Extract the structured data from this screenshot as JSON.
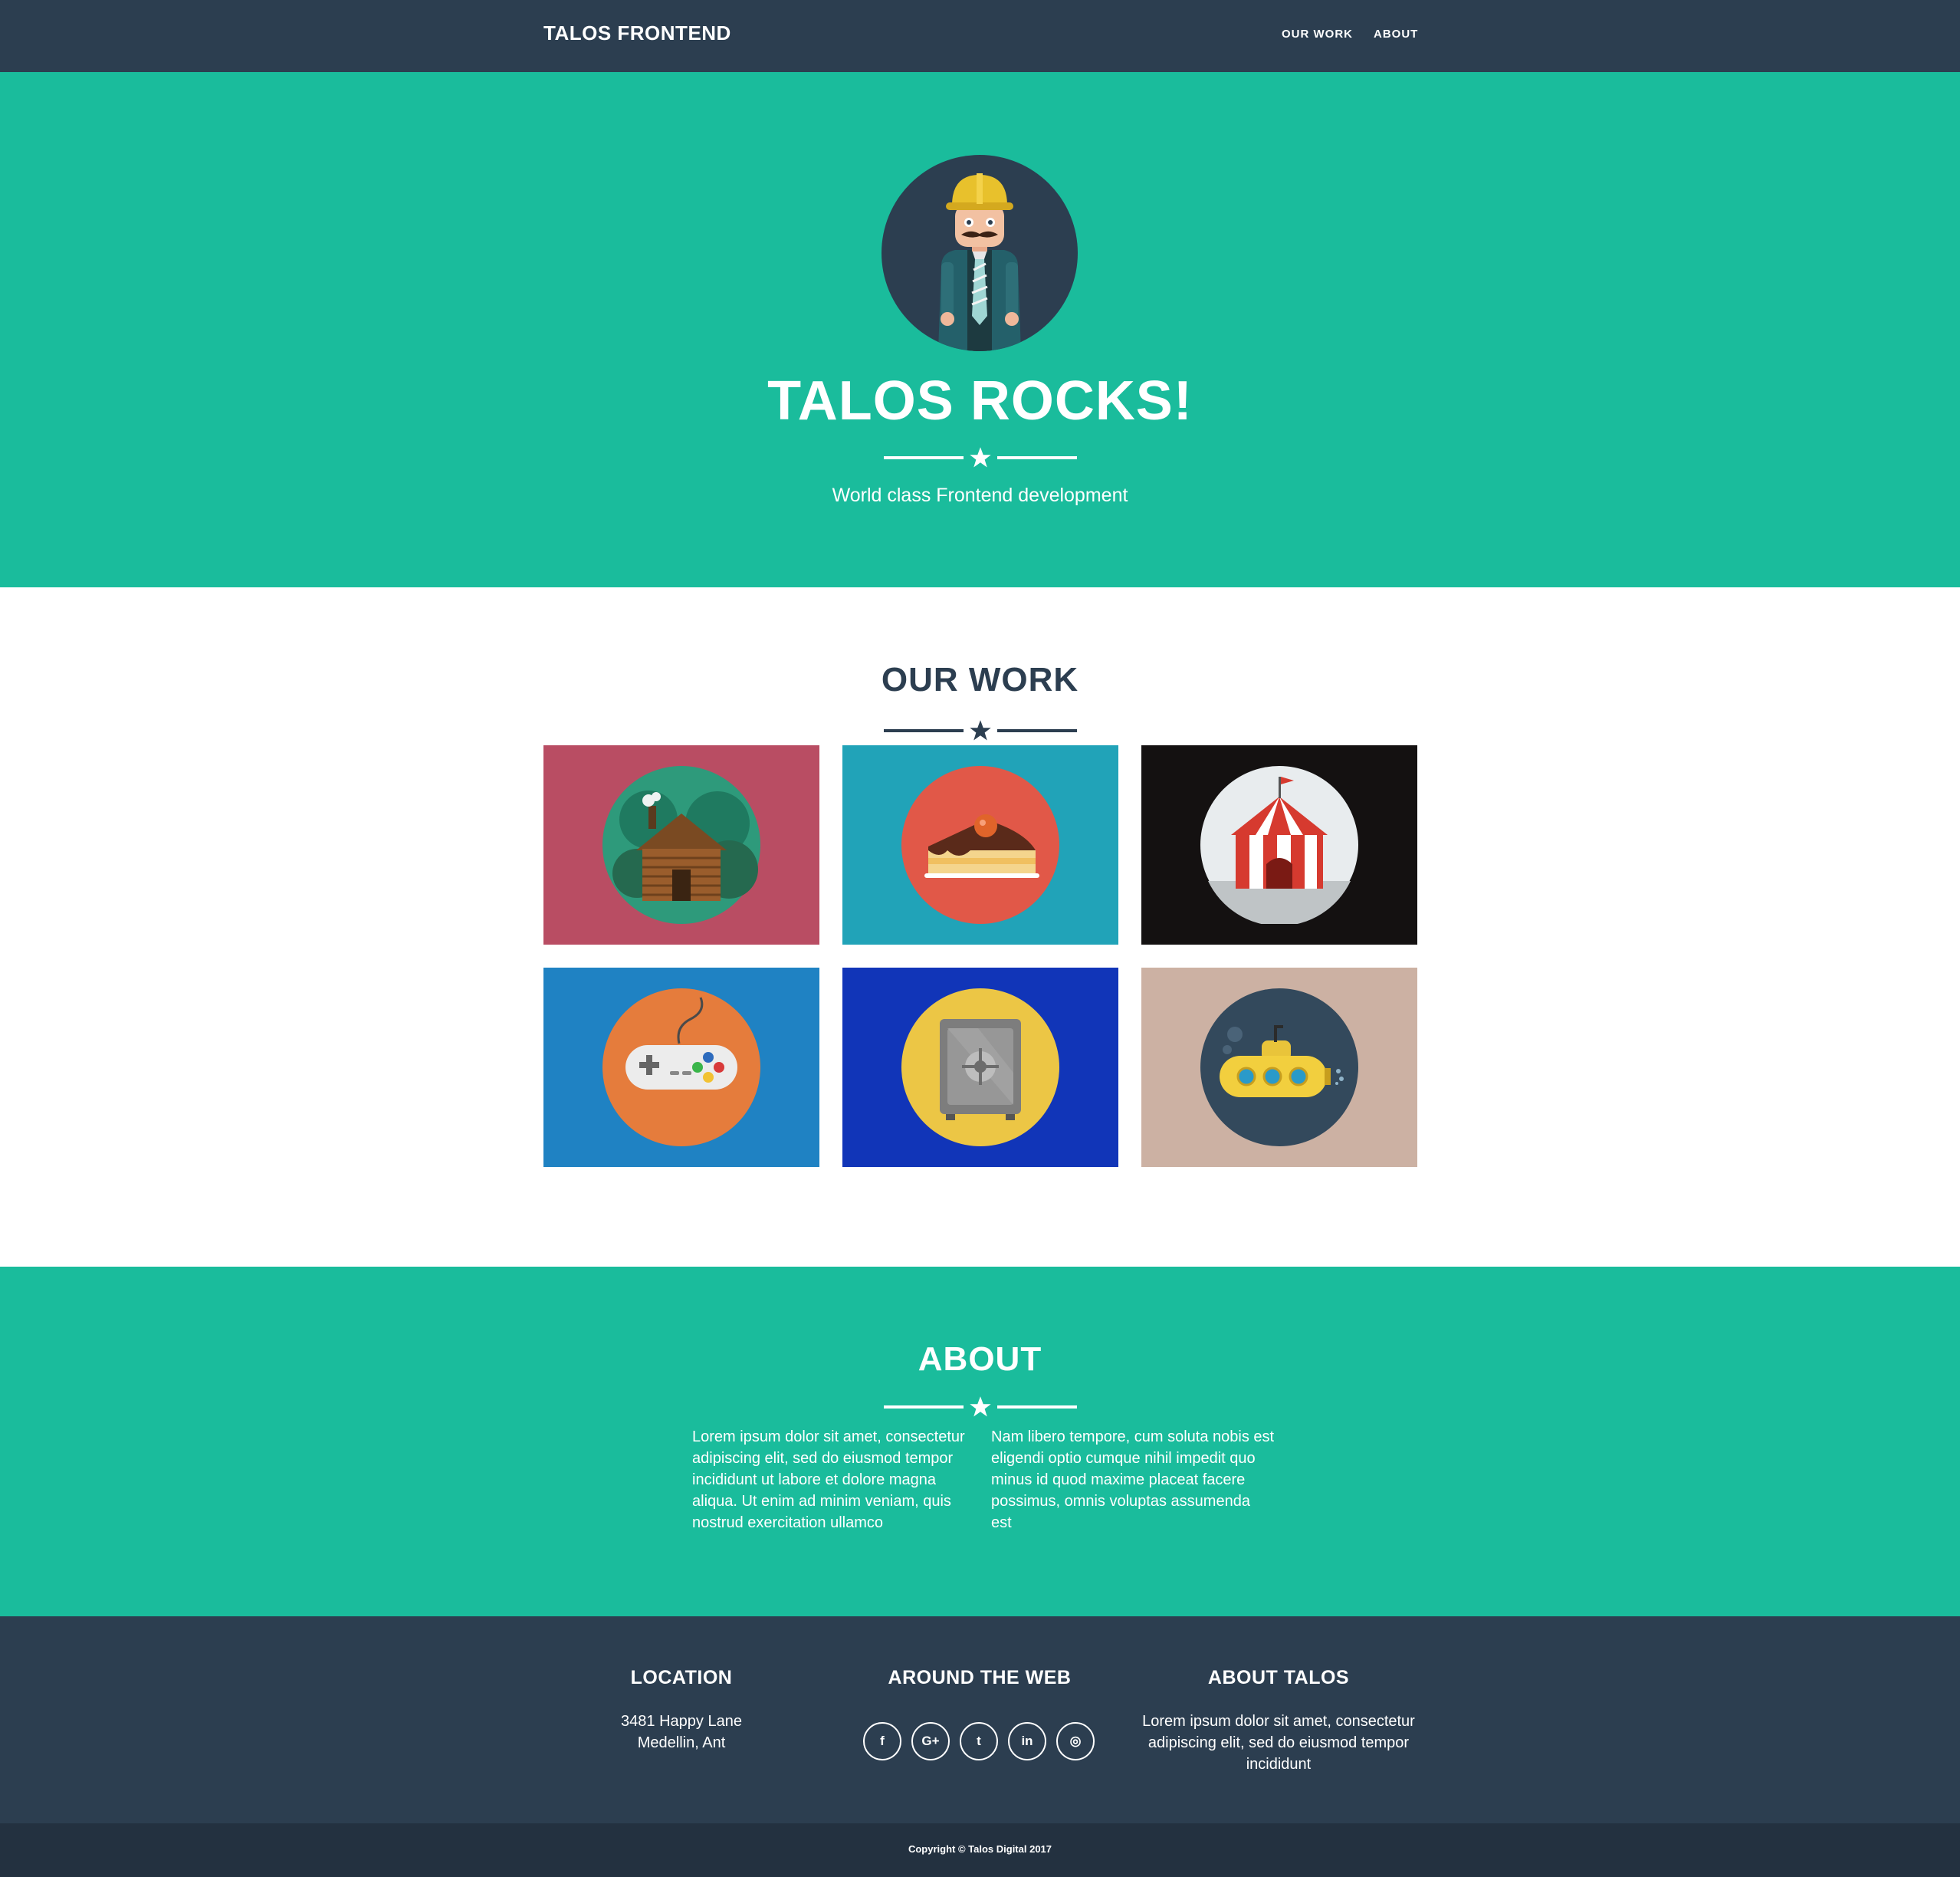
{
  "nav": {
    "brand": "TALOS FRONTEND",
    "links": [
      "OUR WORK",
      "ABOUT"
    ]
  },
  "hero": {
    "title": "TALOS ROCKS!",
    "subtitle": "World class Frontend development"
  },
  "work": {
    "title": "OUR WORK",
    "tiles": [
      {
        "icon": "cabin-icon",
        "bg": "#b94d63",
        "circle": "#2e9a7b"
      },
      {
        "icon": "cake-icon",
        "bg": "#21a3b8",
        "circle": "#e15848"
      },
      {
        "icon": "circus-tent-icon",
        "bg": "#141111",
        "circle": "#e8ecee"
      },
      {
        "icon": "game-controller-icon",
        "bg": "#1f82c3",
        "circle": "#e57c3c"
      },
      {
        "icon": "safe-icon",
        "bg": "#1135b8",
        "circle": "#ecc645"
      },
      {
        "icon": "submarine-icon",
        "bg": "#ccb1a3",
        "circle": "#33495c"
      }
    ]
  },
  "about": {
    "title": "ABOUT",
    "col1": "Lorem ipsum dolor sit amet, consectetur adipiscing elit, sed do eiusmod tempor incididunt ut labore et dolore magna aliqua. Ut enim ad minim veniam, quis nostrud exercitation ullamco",
    "col2": "Nam libero tempore, cum soluta nobis est eligendi optio cumque nihil impedit quo minus id quod maxime placeat facere possimus, omnis voluptas assumenda est"
  },
  "footer": {
    "location": {
      "title": "LOCATION",
      "line1": "3481 Happy Lane",
      "line2": "Medellin, Ant"
    },
    "web": {
      "title": "AROUND THE WEB",
      "socials": [
        {
          "icon": "facebook-icon",
          "glyph": "f"
        },
        {
          "icon": "google-plus-icon",
          "glyph": "G+"
        },
        {
          "icon": "twitter-icon",
          "glyph": "t"
        },
        {
          "icon": "linkedin-icon",
          "glyph": "in"
        },
        {
          "icon": "dribbble-icon",
          "glyph": "◎"
        }
      ]
    },
    "about": {
      "title": "ABOUT TALOS",
      "text": "Lorem ipsum dolor sit amet, consectetur adipiscing elit, sed do eiusmod tempor incididunt"
    },
    "copyright": "Copyright © Talos Digital 2017"
  },
  "colors": {
    "navy": "#2c3e50",
    "turquoise": "#1abc9c",
    "copybar": "#233140"
  }
}
